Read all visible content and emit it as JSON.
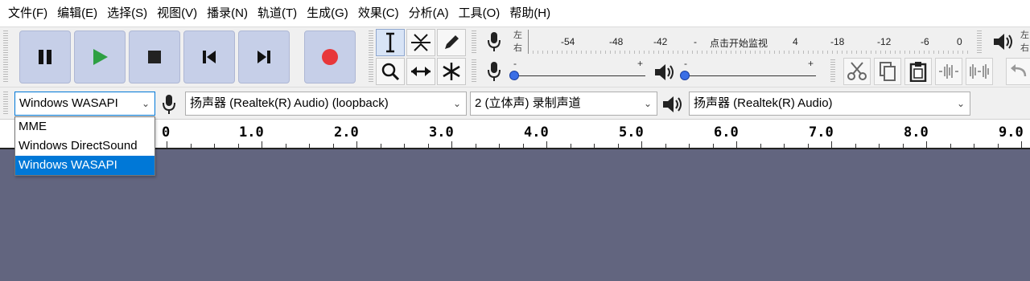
{
  "menu": [
    "文件(F)",
    "编辑(E)",
    "选择(S)",
    "视图(V)",
    "播录(N)",
    "轨道(T)",
    "生成(G)",
    "效果(C)",
    "分析(A)",
    "工具(O)",
    "帮助(H)"
  ],
  "transport": {
    "pause": "pause-icon",
    "play": "play-icon",
    "stop": "stop-icon",
    "skip_start": "skip-to-start-icon",
    "skip_end": "skip-to-end-icon",
    "record": "record-icon",
    "record_color": "#e8373a",
    "play_color": "#2ea043"
  },
  "meter": {
    "left": "左",
    "right": "右",
    "scale": [
      "-54",
      "-48",
      "-42",
      "-",
      "4",
      "-18",
      "-12",
      "-6",
      "0"
    ],
    "hint": "点击开始监视",
    "right_edge_left": "左",
    "right_edge_right": "右"
  },
  "sliders": {
    "input_min": "-",
    "input_max": "+",
    "output_min": "-",
    "output_max": "+"
  },
  "devices": {
    "host": "Windows WASAPI",
    "recording_device": "扬声器 (Realtek(R) Audio) (loopback)",
    "channels": "2 (立体声) 录制声道",
    "playback_device": "扬声器 (Realtek(R) Audio)"
  },
  "host_options": [
    "MME",
    "Windows DirectSound",
    "Windows WASAPI"
  ],
  "host_selected_index": 2,
  "ruler": [
    "0",
    "1.0",
    "2.0",
    "3.0",
    "4.0",
    "5.0",
    "6.0",
    "7.0",
    "8.0",
    "9.0"
  ],
  "colors": {
    "track_background": "#62657f",
    "selection": "#0078d7"
  }
}
